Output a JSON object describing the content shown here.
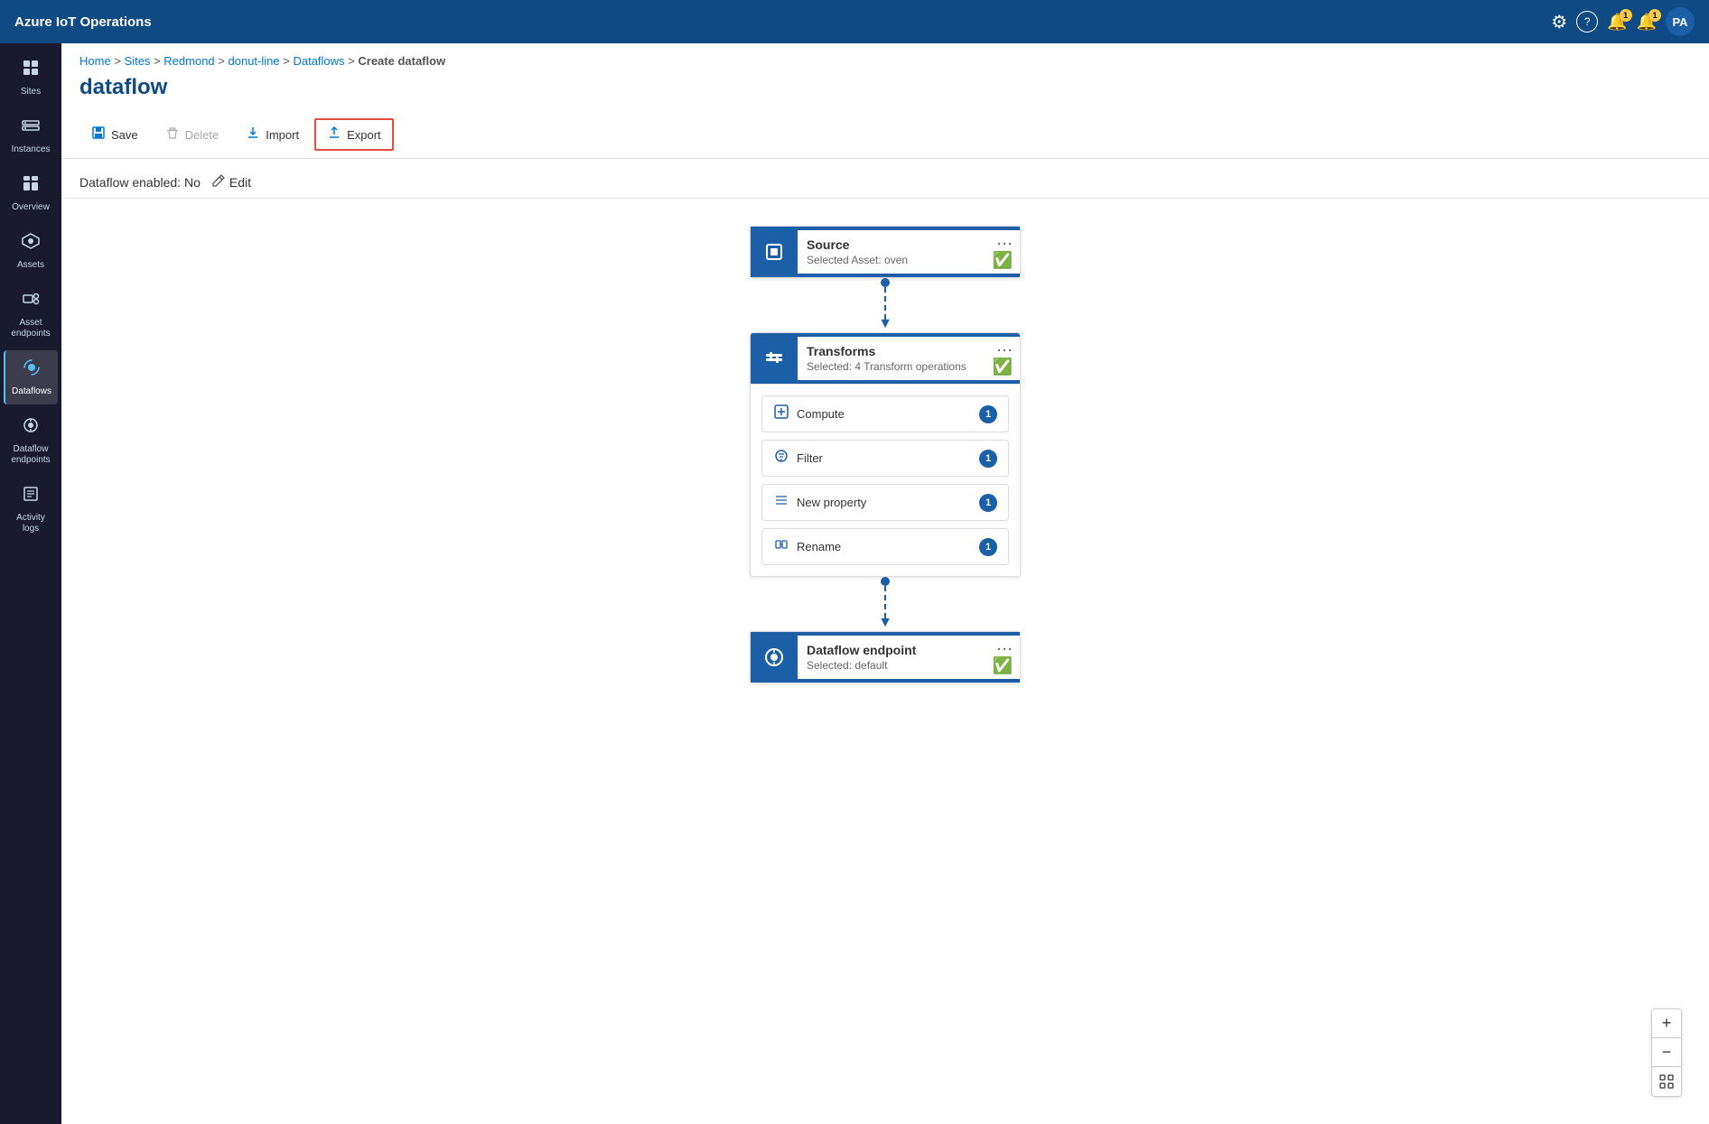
{
  "app": {
    "title": "Azure IoT Operations"
  },
  "topnav": {
    "title": "Azure IoT Operations",
    "icons": {
      "settings": "⚙",
      "help": "?",
      "notifications1_count": "1",
      "notifications2_count": "1"
    },
    "avatar_initials": "PA"
  },
  "sidebar": {
    "items": [
      {
        "id": "sites",
        "label": "Sites",
        "icon": "🏠"
      },
      {
        "id": "instances",
        "label": "Instances",
        "icon": "⬚"
      },
      {
        "id": "overview",
        "label": "Overview",
        "icon": "▦"
      },
      {
        "id": "assets",
        "label": "Assets",
        "icon": "◈"
      },
      {
        "id": "asset-endpoints",
        "label": "Asset endpoints",
        "icon": "⊡"
      },
      {
        "id": "dataflows",
        "label": "Dataflows",
        "icon": "⇌",
        "active": true
      },
      {
        "id": "dataflow-endpoints",
        "label": "Dataflow endpoints",
        "icon": "⊙"
      },
      {
        "id": "activity-logs",
        "label": "Activity logs",
        "icon": "≡"
      }
    ]
  },
  "breadcrumb": {
    "items": [
      "Home",
      "Sites",
      "Redmond",
      "donut-line",
      "Dataflows",
      "Create dataflow"
    ],
    "separators": [
      ">",
      ">",
      ">",
      ">",
      ">"
    ]
  },
  "page": {
    "title": "dataflow"
  },
  "toolbar": {
    "save_label": "Save",
    "delete_label": "Delete",
    "import_label": "Import",
    "export_label": "Export"
  },
  "canvas_header": {
    "status_label": "Dataflow enabled: No",
    "edit_label": "Edit"
  },
  "flow": {
    "source": {
      "title": "Source",
      "subtitle": "Selected Asset: oven",
      "icon": "◻"
    },
    "transforms": {
      "title": "Transforms",
      "subtitle": "Selected: 4 Transform operations",
      "icon": "⊞",
      "items": [
        {
          "id": "compute",
          "label": "Compute",
          "count": "1",
          "icon": "⊡"
        },
        {
          "id": "filter",
          "label": "Filter",
          "count": "1",
          "icon": "⊟"
        },
        {
          "id": "new-property",
          "label": "New property",
          "count": "1",
          "icon": "≡"
        },
        {
          "id": "rename",
          "label": "Rename",
          "count": "1",
          "icon": "⊠"
        }
      ]
    },
    "endpoint": {
      "title": "Dataflow endpoint",
      "subtitle": "Selected: default",
      "icon": "⊕"
    }
  },
  "zoom": {
    "plus": "+",
    "minus": "−",
    "fit": "⊡"
  }
}
